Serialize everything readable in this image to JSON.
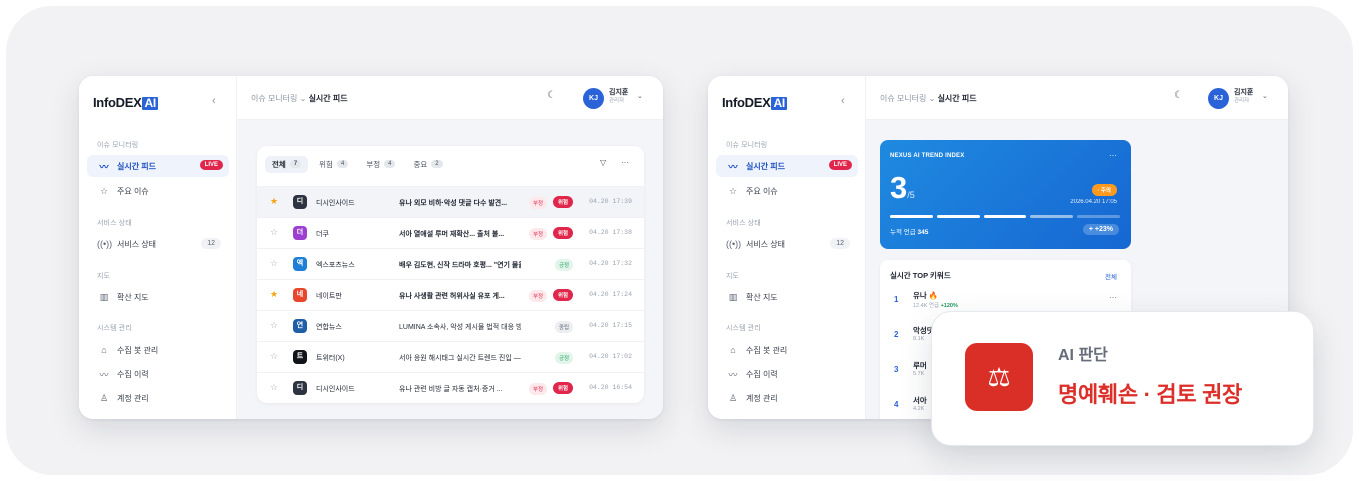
{
  "logo": {
    "text": "InfoDEX",
    "ai": "AI"
  },
  "sidebar": {
    "collapse_icon": "chevron-left-icon",
    "sections": [
      {
        "title": "이슈 모니터링",
        "items": [
          {
            "label": "실시간 피드",
            "icon": "pulse-icon",
            "badge": "LIVE",
            "active": true
          },
          {
            "label": "주요 이슈",
            "icon": "star-icon"
          }
        ]
      },
      {
        "title": "서비스 상태",
        "items": [
          {
            "label": "서비스 상태",
            "icon": "signal-icon",
            "count": "12"
          }
        ]
      },
      {
        "title": "지도",
        "items": [
          {
            "label": "확산 지도",
            "icon": "map-icon"
          }
        ]
      },
      {
        "title": "시스템 관리",
        "items": [
          {
            "label": "수집 봇 관리",
            "icon": "bot-icon"
          },
          {
            "label": "수집 이력",
            "icon": "pulse-icon"
          },
          {
            "label": "계정 관리",
            "icon": "user-icon"
          }
        ]
      }
    ]
  },
  "topbar": {
    "breadcrumb_parent": "이슈 모니터링",
    "breadcrumb_sep": "⌄",
    "breadcrumb_current": "실시간 피드",
    "theme_icon": "moon-icon",
    "user": {
      "initials": "KJ",
      "name": "김지훈",
      "role": "관리자"
    }
  },
  "feed": {
    "tabs": [
      {
        "label": "전체",
        "count": "7",
        "selected": true
      },
      {
        "label": "위험",
        "count": "4"
      },
      {
        "label": "부정",
        "count": "4"
      },
      {
        "label": "중요",
        "count": "2"
      }
    ],
    "filter_icon": "filter-icon",
    "more_icon": "more-icon",
    "rows": [
      {
        "starred": true,
        "source_letter": "디",
        "source": "디시인사이드",
        "source_color": "#2d3340",
        "title": "유나 외모 비하·악성 댓글 다수 발견...",
        "sentiment": "부정",
        "sentiment_kind": "neg",
        "risk": "위험",
        "time": "04.20 17:39",
        "highlight": true
      },
      {
        "starred": false,
        "source_letter": "더",
        "source": "더쿠",
        "source_color": "#9c3fd0",
        "title": "서아 열애설 루머 재확산... 출처 불...",
        "sentiment": "부정",
        "sentiment_kind": "neg",
        "risk": "위험",
        "time": "04.20 17:38"
      },
      {
        "starred": false,
        "source_letter": "엑",
        "source": "엑스포츠뉴스",
        "source_color": "#1e7fd6",
        "title": "배우 김도현, 신작 드라마 호평... \"연기 물올...",
        "sentiment": "긍정",
        "sentiment_kind": "pos",
        "risk": "",
        "time": "04.20 17:32"
      },
      {
        "starred": true,
        "source_letter": "네",
        "source": "네이트판",
        "source_color": "#e8472e",
        "title": "유나 사생활 관련 허위사실 유포 게...",
        "sentiment": "부정",
        "sentiment_kind": "neg",
        "risk": "위험",
        "time": "04.20 17:24"
      },
      {
        "starred": false,
        "source_letter": "연",
        "source": "연합뉴스",
        "source_color": "#1f5fa8",
        "title": "LUMINA 소속사, 악성 게시물 법적 대응 방...",
        "sentiment": "중립",
        "sentiment_kind": "neu",
        "risk": "",
        "time": "04.20 17:15",
        "lite": true
      },
      {
        "starred": false,
        "source_letter": "트",
        "source": "트위터(X)",
        "source_color": "#111418",
        "title": "서아 응원 해시태그 실시간 트렌드 진입 — ...",
        "sentiment": "긍정",
        "sentiment_kind": "pos",
        "risk": "",
        "time": "04.20 17:02",
        "lite": true
      },
      {
        "starred": false,
        "source_letter": "디",
        "source": "디시인사이드",
        "source_color": "#2d3340",
        "title": "유나 관련 비방 글 자동 캡처·증거 ...",
        "sentiment": "부정",
        "sentiment_kind": "neg",
        "risk": "위험",
        "time": "04.20 16:54",
        "lite": true
      }
    ]
  },
  "trend": {
    "label": "NEXUS AI TREND INDEX",
    "more": "···",
    "score": "3",
    "score_max": "/5",
    "status": "· 주의",
    "date": "2026.04.20 17:05",
    "level": 0.6,
    "cumulative_label": "누적 언급",
    "cumulative_value": "345",
    "delta": "+ +23%"
  },
  "keywords": {
    "title": "실시간 TOP 키워드",
    "all_label": "전체",
    "items": [
      {
        "rank": "1",
        "name": "유나",
        "fire": "🔥",
        "stat": "12.4K 언급",
        "change": "+120%"
      },
      {
        "rank": "2",
        "name": "악성댓글",
        "stat": "8.1K"
      },
      {
        "rank": "3",
        "name": "루머",
        "stat": "5.7K"
      },
      {
        "rank": "4",
        "name": "서아",
        "stat": "4.2K"
      }
    ]
  },
  "ai_judgement": {
    "label": "AI 판단",
    "verdict": "명예훼손 · 검토 권장",
    "icon": "scales-icon"
  }
}
